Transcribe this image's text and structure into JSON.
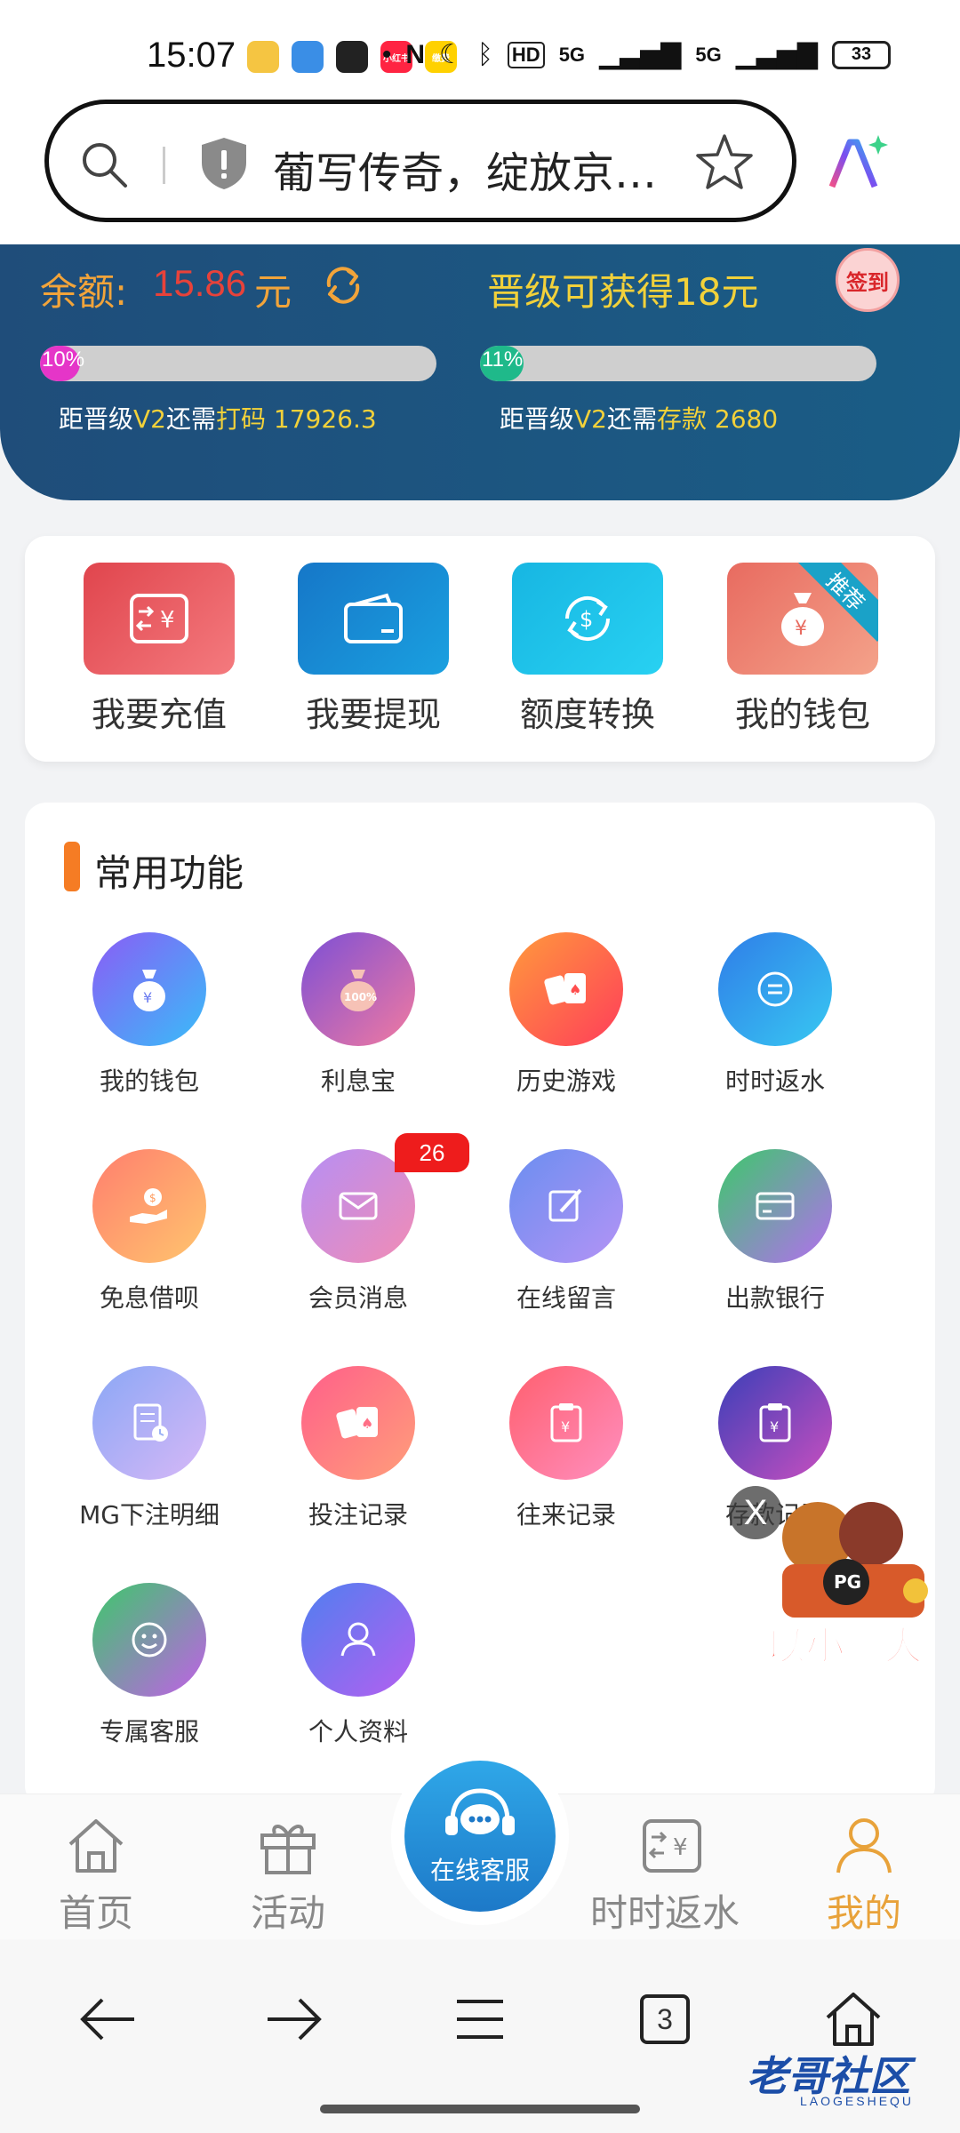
{
  "status_bar": {
    "time": "15:07",
    "app_icons": [
      {
        "name": "weibo-icon",
        "color": "#f5c542",
        "text": ""
      },
      {
        "name": "wallet-app-icon",
        "color": "#3a8ee6",
        "text": ""
      },
      {
        "name": "wechat-icon",
        "color": "#222222",
        "text": ""
      },
      {
        "name": "xiaohongshu-icon",
        "color": "#ff2442",
        "text": "小红书"
      },
      {
        "name": "meituan-icon",
        "color": "#ffd100",
        "text": "缴费"
      }
    ],
    "network_5g_1": "5G",
    "network_5g_2": "5G",
    "hd_label": "HD",
    "battery": "33"
  },
  "address_bar": {
    "text": "葡写传奇，绽放京…"
  },
  "header": {
    "balance_label": "余额:",
    "balance_value": "15.86",
    "balance_unit": "元",
    "upgrade_text": "晋级可获得18元",
    "sign_in": "签到",
    "progress_left": {
      "percent_label": "10%",
      "fraction": 0.1,
      "note_prefix": "距晋级",
      "note_level": "V2",
      "note_mid": "还需",
      "note_type": "打码",
      "note_value": "17926.3"
    },
    "progress_right": {
      "percent_label": "11%",
      "fraction": 0.11,
      "note_prefix": "距晋级",
      "note_level": "V2",
      "note_mid": "还需",
      "note_type": "存款",
      "note_value": "2680"
    }
  },
  "quick_actions": [
    {
      "label": "我要充值",
      "icon": "recharge-icon",
      "color_a": "#e0454d",
      "color_b": "#f47a7e"
    },
    {
      "label": "我要提现",
      "icon": "withdraw-icon",
      "color_a": "#1677c8",
      "color_b": "#1aa0e0"
    },
    {
      "label": "额度转换",
      "icon": "transfer-icon",
      "color_a": "#17b6e2",
      "color_b": "#28d1f2"
    },
    {
      "label": "我的钱包",
      "icon": "wallet-bag-icon",
      "color_a": "#e86b60",
      "color_b": "#f4a28a",
      "ribbon": "推荐"
    }
  ],
  "common": {
    "title": "常用功能",
    "items": [
      {
        "label": "我的钱包",
        "icon": "money-bag-icon",
        "c1": "#8b5cf6",
        "c2": "#38bdf8"
      },
      {
        "label": "利息宝",
        "icon": "interest-bag-icon",
        "c1": "#7b4fd6",
        "c2": "#f27aa0"
      },
      {
        "label": "历史游戏",
        "icon": "cards-icon",
        "c1": "#ff9a3c",
        "c2": "#ff3d5a"
      },
      {
        "label": "时时返水",
        "icon": "refresh-icon",
        "c1": "#2f7de8",
        "c2": "#38c8f2"
      },
      {
        "label": "免息借呗",
        "icon": "hand-coin-icon",
        "c1": "#ff7e6e",
        "c2": "#ffc56e"
      },
      {
        "label": "会员消息",
        "icon": "mail-icon",
        "c1": "#b58ef5",
        "c2": "#f28cb4"
      },
      {
        "label": "在线留言",
        "icon": "edit-icon",
        "c1": "#6a8ef0",
        "c2": "#b493f5"
      },
      {
        "label": "出款银行",
        "icon": "bank-card-icon",
        "c1": "#3cc96a",
        "c2": "#b46ef0"
      },
      {
        "label": "MG下注明细",
        "icon": "document-clock-icon",
        "c1": "#8aa7f5",
        "c2": "#d7b8f7"
      },
      {
        "label": "投注记录",
        "icon": "bet-cards-icon",
        "c1": "#ff5f8a",
        "c2": "#ff9e7a"
      },
      {
        "label": "往来记录",
        "icon": "clipboard-yen-icon",
        "c1": "#ff5f6e",
        "c2": "#ff8fbf"
      },
      {
        "label": "存款记录",
        "icon": "clipboard-yen-icon",
        "c1": "#3a3fb8",
        "c2": "#c94fbf"
      },
      {
        "label": "专属客服",
        "icon": "service-face-icon",
        "c1": "#3cc96a",
        "c2": "#c25fe8"
      },
      {
        "label": "个人资料",
        "icon": "user-icon",
        "c1": "#4f7ff0",
        "c2": "#b55ff0"
      }
    ],
    "message_badge": "26"
  },
  "promo": {
    "text": "以小博大",
    "close": "X"
  },
  "bottom_nav": {
    "home": "首页",
    "activity": "活动",
    "service": "在线客服",
    "rebate": "时时返水",
    "mine": "我的"
  },
  "browser_bar": {
    "tab_count": "3"
  },
  "watermark": {
    "text": "老哥社区",
    "sub": "LAOGESHEQU"
  }
}
